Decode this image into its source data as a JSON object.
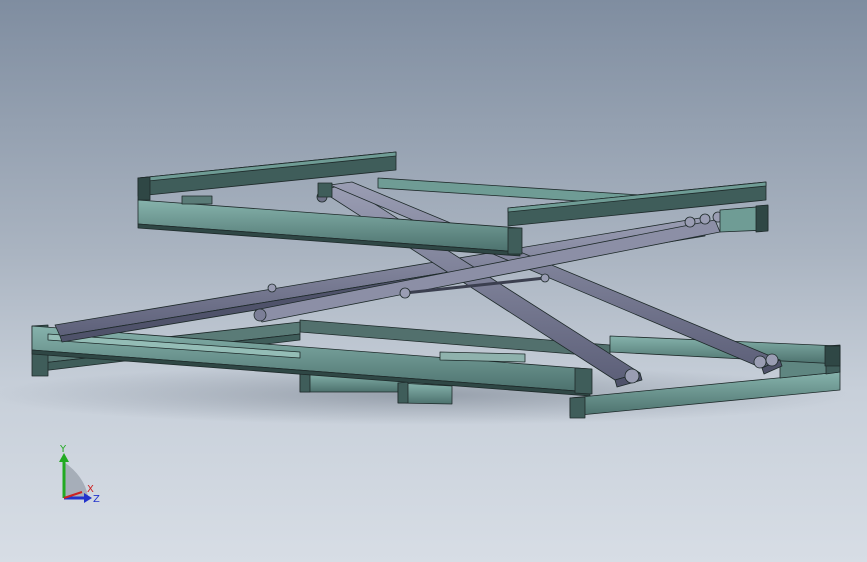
{
  "view": {
    "type": "3d-cad-viewport",
    "model": "scissor-lift-frame"
  },
  "colors": {
    "background_top": "#7f8da0",
    "background_bottom": "#d7dde5",
    "frame_face": "#6f9c95",
    "frame_dark": "#3f5d5a",
    "scissor_arm": "#7c7f97",
    "scissor_dark": "#4f526a",
    "edge": "#1e2a2a"
  },
  "triad": {
    "x_label": "X",
    "y_label": "Y",
    "z_label": "Z",
    "x_color": "#cc2222",
    "y_color": "#22aa22",
    "z_color": "#2233cc"
  }
}
